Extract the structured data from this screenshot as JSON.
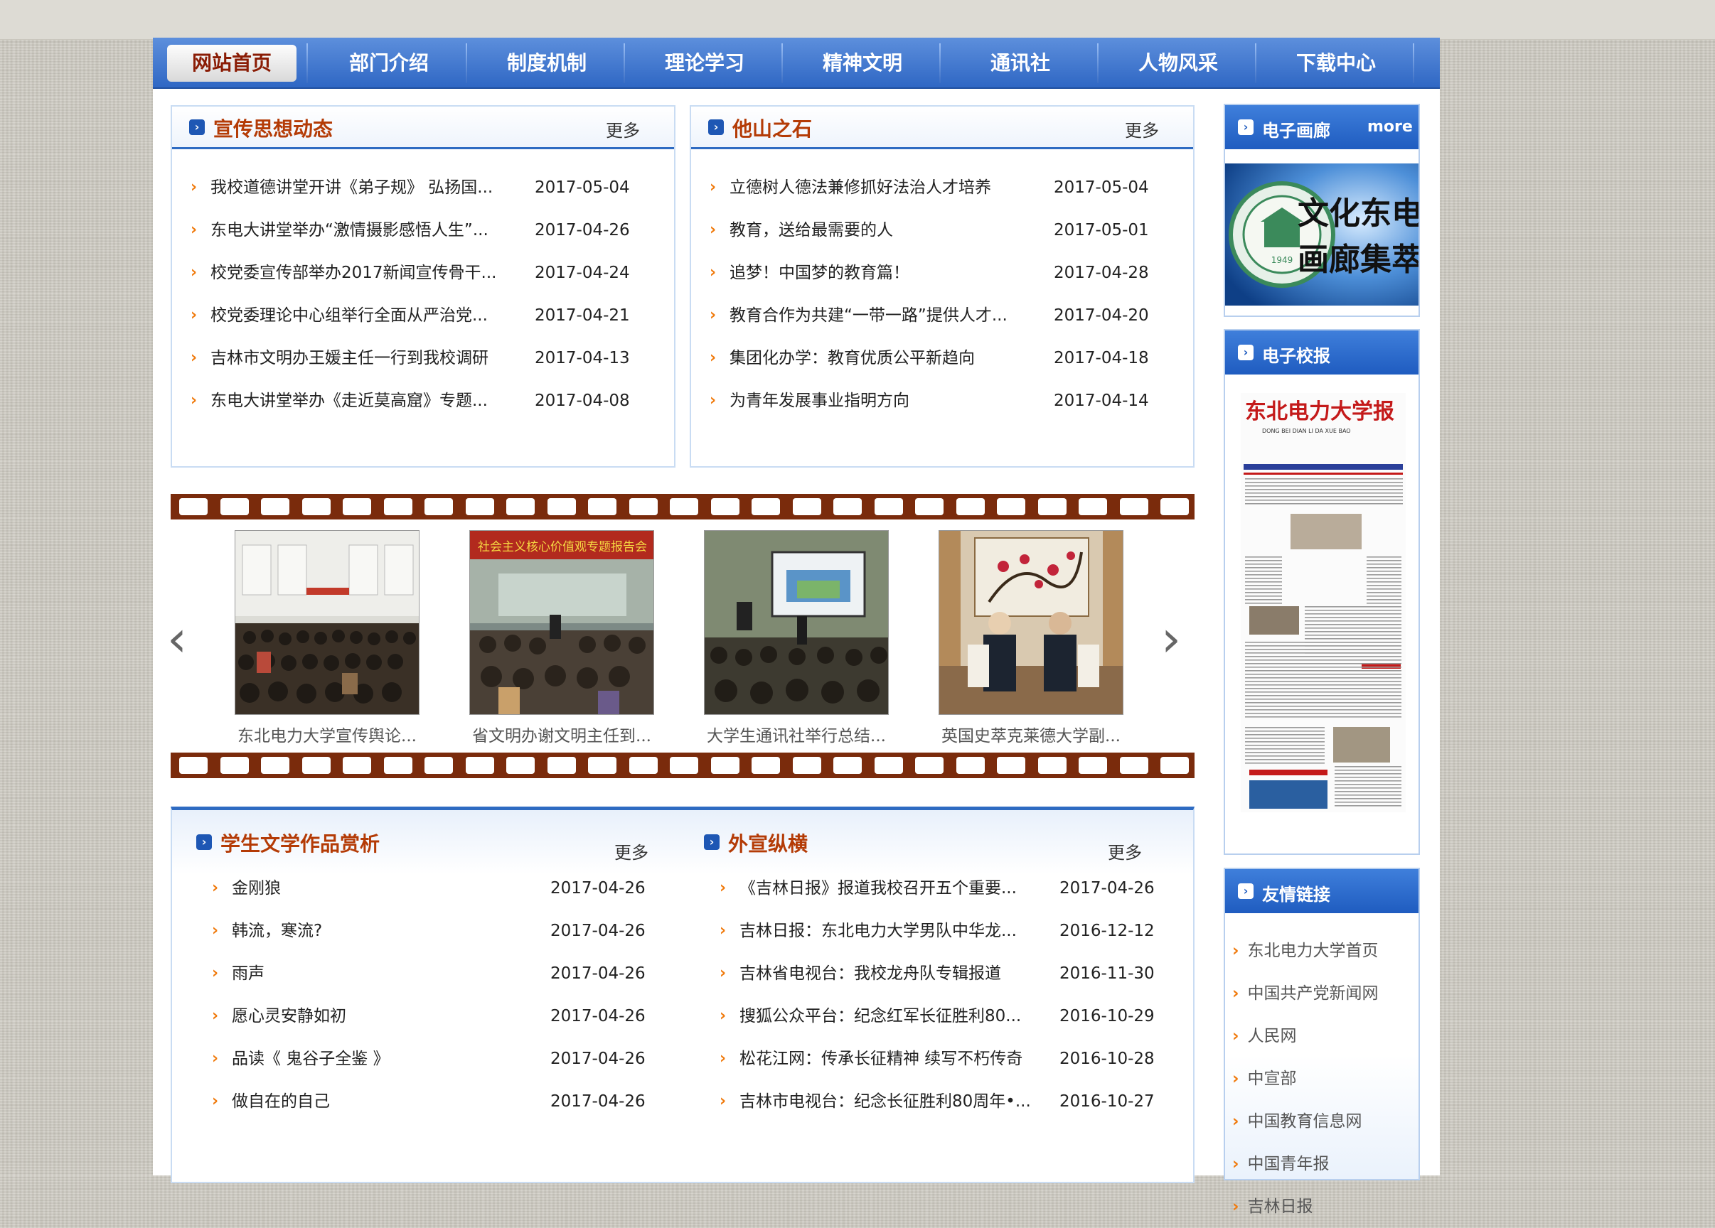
{
  "nav": {
    "items": [
      "网站首页",
      "部门介绍",
      "制度机制",
      "理论学习",
      "精神文明",
      "通讯社",
      "人物风采",
      "下载中心"
    ]
  },
  "more_label": "更多",
  "panels": {
    "propaganda": {
      "title": "宣传思想动态",
      "items": [
        {
          "title": "我校道德讲堂开讲《弟子规》 弘扬国...",
          "date": "2017-05-04"
        },
        {
          "title": "东电大讲堂举办“激情摄影感悟人生”...",
          "date": "2017-04-26"
        },
        {
          "title": "校党委宣传部举办2017新闻宣传骨干...",
          "date": "2017-04-24"
        },
        {
          "title": "校党委理论中心组举行全面从严治党...",
          "date": "2017-04-21"
        },
        {
          "title": "吉林市文明办王媛主任一行到我校调研",
          "date": "2017-04-13"
        },
        {
          "title": "东电大讲堂举办《走近莫高窟》专题...",
          "date": "2017-04-08"
        }
      ]
    },
    "tashan": {
      "title": "他山之石",
      "items": [
        {
          "title": "立德树人德法兼修抓好法治人才培养",
          "date": "2017-05-04"
        },
        {
          "title": "教育，送给最需要的人",
          "date": "2017-05-01"
        },
        {
          "title": "追梦！中国梦的教育篇！",
          "date": "2017-04-28"
        },
        {
          "title": "教育合作为共建“一带一路”提供人才...",
          "date": "2017-04-20"
        },
        {
          "title": "集团化办学：教育优质公平新趋向",
          "date": "2017-04-18"
        },
        {
          "title": "为青年发展事业指明方向",
          "date": "2017-04-14"
        }
      ]
    },
    "literature": {
      "title": "学生文学作品赏析",
      "items": [
        {
          "title": "金刚狼",
          "date": "2017-04-26"
        },
        {
          "title": "韩流，寒流?",
          "date": "2017-04-26"
        },
        {
          "title": "雨声",
          "date": "2017-04-26"
        },
        {
          "title": "愿心灵安静如初",
          "date": "2017-04-26"
        },
        {
          "title": "品读《 鬼谷子全鉴 》",
          "date": "2017-04-26"
        },
        {
          "title": "做自在的自己",
          "date": "2017-04-26"
        }
      ]
    },
    "external": {
      "title": "外宣纵横",
      "items": [
        {
          "title": "《吉林日报》报道我校召开五个重要...",
          "date": "2017-04-26"
        },
        {
          "title": "吉林日报：东北电力大学男队中华龙...",
          "date": "2016-12-12"
        },
        {
          "title": "吉林省电视台：我校龙舟队专辑报道",
          "date": "2016-11-30"
        },
        {
          "title": "搜狐公众平台：纪念红军长征胜利80...",
          "date": "2016-10-29"
        },
        {
          "title": "松花江网：传承长征精神 续写不朽传奇",
          "date": "2016-10-28"
        },
        {
          "title": "吉林市电视台：纪念长征胜利80周年•...",
          "date": "2016-10-27"
        }
      ]
    }
  },
  "gallery": {
    "captions": [
      "东北电力大学宣传舆论...",
      "省文明办谢文明主任到...",
      "大学生通讯社举行总结...",
      "英国史萃克莱德大学副..."
    ],
    "banner_text": "社会主义核心价值观专题报告会"
  },
  "sidebar": {
    "gallery": {
      "title": "电子画廊",
      "more": "more",
      "banner_line1": "文化东电",
      "banner_line2": "画廊集萃",
      "seal_year": "1949"
    },
    "newspaper": {
      "title": "电子校报",
      "masthead": "东北电力大学报",
      "pinyin": "DONG BEI DIAN LI DA XUE BAO"
    },
    "links": {
      "title": "友情链接",
      "items": [
        "东北电力大学首页",
        "中国共产党新闻网",
        "人民网",
        "中宣部",
        "中国教育信息网",
        "中国青年报",
        "吉林日报"
      ]
    }
  },
  "colors": {
    "nav": "#2f67c4",
    "title": "#b43b06",
    "arrow": "#f07a0c",
    "film": "#7a2b0c"
  }
}
